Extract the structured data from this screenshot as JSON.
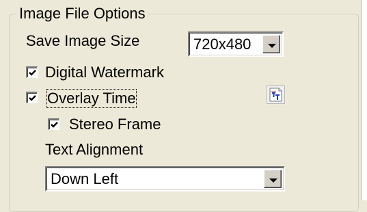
{
  "group": {
    "title": "Image File Options"
  },
  "save_image_size": {
    "label": "Save Image Size",
    "value": "720x480"
  },
  "digital_watermark": {
    "label": "Digital Watermark",
    "checked": true
  },
  "overlay_time": {
    "label": "Overlay Time",
    "checked": true
  },
  "overlay_text_button": {
    "icon": "text-format-icon"
  },
  "stereo_frame": {
    "label": "Stereo Frame",
    "checked": true
  },
  "text_alignment": {
    "label": "Text Alignment",
    "value": "Down Left"
  }
}
